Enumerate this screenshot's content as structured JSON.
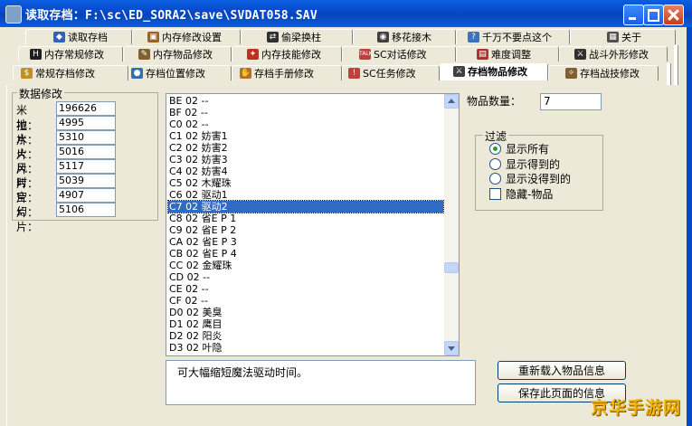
{
  "window": {
    "title": "读取存档：F:\\sc\\ED_SORA2\\save\\SVDAT058.SAV",
    "accent": "#0a5fe0"
  },
  "tabs_row1": [
    {
      "label": "读取存档",
      "icon": "diamond-icon",
      "color": "#3060c0"
    },
    {
      "label": "内存修改设置",
      "icon": "box-icon",
      "color": "#a06020"
    },
    {
      "label": "偷梁换柱",
      "icon": "swap-icon",
      "color": "#303030"
    },
    {
      "label": "移花接木",
      "icon": "record-icon",
      "color": "#404040"
    },
    {
      "label": "千万不要点这个",
      "icon": "question-icon",
      "color": "#4070c0"
    },
    {
      "label": "关于",
      "icon": "chip-icon",
      "color": "#505050"
    }
  ],
  "tabs_row2": [
    {
      "label": "内存常规修改",
      "icon": "hp-icon",
      "color": "#202020"
    },
    {
      "label": "内存物品修改",
      "icon": "pen-icon",
      "color": "#806030"
    },
    {
      "label": "内存技能修改",
      "icon": "skill-icon",
      "color": "#c03020"
    },
    {
      "label": "SC对话修改",
      "icon": "talk-icon",
      "color": "#c04040"
    },
    {
      "label": "难度调整",
      "icon": "chart-icon",
      "color": "#b03030"
    },
    {
      "label": "战斗外形修改",
      "icon": "fighter-icon",
      "color": "#303030"
    }
  ],
  "tabs_row3": [
    {
      "label": "常规存档修改",
      "icon": "money-icon",
      "color": "#c09020"
    },
    {
      "label": "存档位置修改",
      "icon": "disc-icon",
      "color": "#3070b0"
    },
    {
      "label": "存档手册修改",
      "icon": "hand-icon",
      "color": "#b07030"
    },
    {
      "label": "SC任务修改",
      "icon": "quest-icon",
      "color": "#c04040"
    },
    {
      "label": "存档物品修改",
      "icon": "sword-icon",
      "color": "#404040"
    },
    {
      "label": "存档战技修改",
      "icon": "battle-icon",
      "color": "#806030"
    }
  ],
  "data_panel": {
    "title": "数据修改",
    "fields": [
      {
        "label": "米拉：",
        "value": "196626"
      },
      {
        "label": "地片：",
        "value": "4995"
      },
      {
        "label": "水片：",
        "value": "5310"
      },
      {
        "label": "火片：",
        "value": "5016"
      },
      {
        "label": "风片：",
        "value": "5117"
      },
      {
        "label": "时片：",
        "value": "5039"
      },
      {
        "label": "空片：",
        "value": "4907"
      },
      {
        "label": "幻片：",
        "value": "5106"
      }
    ]
  },
  "item_list": [
    "BE 02 --",
    "BF 02 --",
    "C0 02 --",
    "C1 02 妨害1",
    "C2 02 妨害2",
    "C3 02 妨害3",
    "C4 02 妨害4",
    "C5 02 木耀珠",
    "C6 02 驱动1",
    "C7 02 驱动2",
    "C8 02 省E P 1",
    "C9 02 省E P 2",
    "CA 02 省E P 3",
    "CB 02 省E P 4",
    "CC 02 金耀珠",
    "CD 02 --",
    "CE 02 --",
    "CF 02 --",
    "D0 02 美臭",
    "D1 02 鹰目",
    "D2 02 阳炎",
    "D3 02 叶隐"
  ],
  "selected_index": 9,
  "description": "可大幅缩短魔法驱动时间。",
  "quantity": {
    "label": "物品数量：",
    "value": "7"
  },
  "filter": {
    "title": "过滤",
    "options": [
      "显示所有",
      "显示得到的",
      "显示没得到的"
    ],
    "selected": 0,
    "checkbox_label": "隐藏-物品"
  },
  "buttons": {
    "reload": "重新载入物品信息",
    "save": "保存此页面的信息"
  },
  "watermark": "京华手游网",
  "colors": {
    "selection": "#316ac5",
    "face": "#ece9d8"
  }
}
